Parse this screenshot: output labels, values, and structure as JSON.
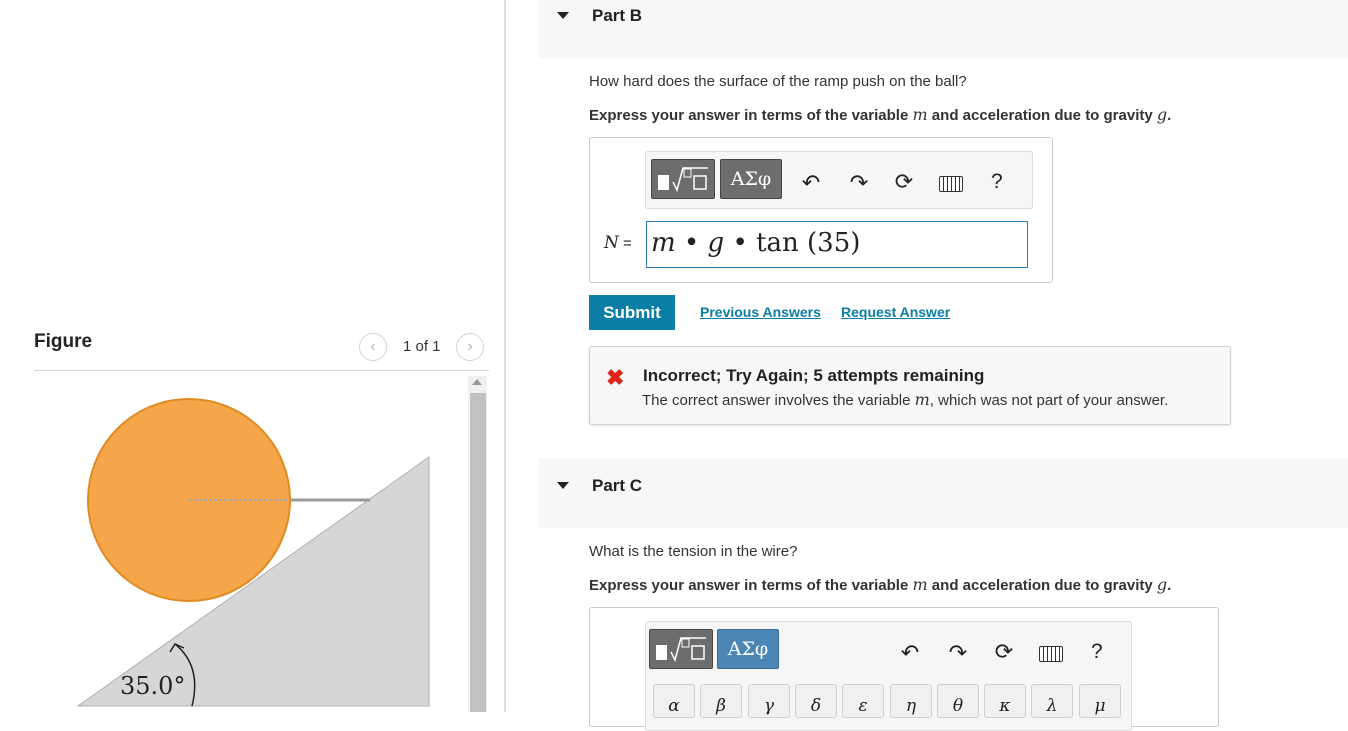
{
  "figure": {
    "title": "Figure",
    "pager": "1 of 1",
    "angle_label": "35.0°",
    "colors": {
      "ball_fill": "#f5a64a",
      "ball_stroke": "#e08a22",
      "ramp_fill": "#d6d6d6",
      "ramp_stroke": "#b0b0b0"
    }
  },
  "part_b": {
    "title": "Part B",
    "question": "How hard does the surface of the ramp push on the ball?",
    "instruction_prefix": "Express your answer in terms of the variable ",
    "var_m": "m",
    "instruction_mid": " and acceleration due to gravity ",
    "var_g": "g",
    "instruction_end": ".",
    "toolbar": {
      "template_icon": "sqrt-template-icon",
      "greek_label": "ΑΣφ",
      "help_label": "?"
    },
    "equation": {
      "lhs": "N",
      "equals": " = ",
      "m": "m",
      "dot1": " • ",
      "g": "g",
      "dot2": " • ",
      "rest": " tan (35)"
    },
    "submit_label": "Submit",
    "previous_answers_label": "Previous Answers",
    "request_answer_label": "Request Answer",
    "feedback": {
      "title": "Incorrect; Try Again; 5 attempts remaining",
      "detail_prefix": "The correct answer involves the variable ",
      "detail_var": "m",
      "detail_suffix": ", which was not part of your answer.",
      "color": "#e2231a"
    }
  },
  "part_c": {
    "title": "Part C",
    "question": "What is the tension in the wire?",
    "instruction_prefix": "Express your answer in terms of the variable ",
    "var_m": "m",
    "instruction_mid": " and acceleration due to gravity ",
    "var_g": "g",
    "instruction_end": ".",
    "toolbar": {
      "greek_label": "ΑΣφ",
      "help_label": "?"
    },
    "greek_keys": [
      "α",
      "β",
      "γ",
      "δ",
      "ε",
      "η",
      "θ",
      "κ",
      "λ",
      "μ"
    ]
  },
  "accent_color": "#0a7ea4"
}
